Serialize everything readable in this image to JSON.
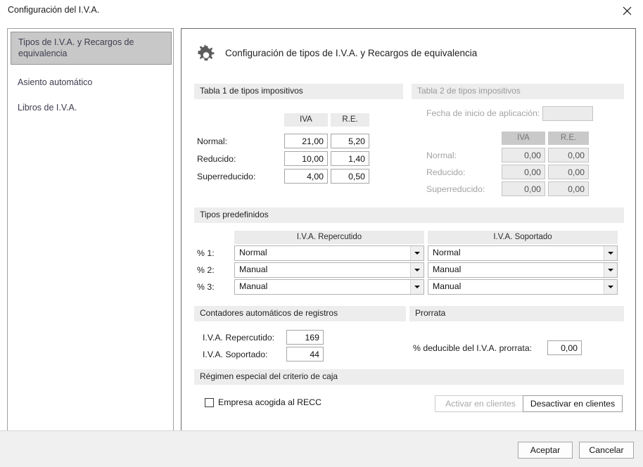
{
  "window": {
    "title": "Configuración del I.V.A.",
    "close_icon": "close-icon"
  },
  "sidebar": {
    "items": [
      {
        "label": "Tipos de I.V.A. y Recargos de equivalencia",
        "selected": true
      },
      {
        "label": "Asiento automático",
        "selected": false
      },
      {
        "label": "Libros de I.V.A.",
        "selected": false
      }
    ]
  },
  "panel": {
    "icon": "gear-icon",
    "heading": "Configuración de tipos de I.V.A. y Recargos de equivalencia"
  },
  "tabla1": {
    "section_title": "Tabla 1 de tipos impositivos",
    "col_iva": "IVA",
    "col_re": "R.E.",
    "rows": [
      {
        "label": "Normal:",
        "iva": "21,00",
        "re": "5,20"
      },
      {
        "label": "Reducido:",
        "iva": "10,00",
        "re": "1,40"
      },
      {
        "label": "Superreducido:",
        "iva": "4,00",
        "re": "0,50"
      }
    ]
  },
  "tabla2": {
    "section_title": "Tabla 2 de tipos impositivos",
    "fecha_label": "Fecha de inicio de aplicación:",
    "fecha_value": "",
    "col_iva": "IVA",
    "col_re": "R.E.",
    "rows": [
      {
        "label": "Normal:",
        "iva": "0,00",
        "re": "0,00"
      },
      {
        "label": "Reducido:",
        "iva": "0,00",
        "re": "0,00"
      },
      {
        "label": "Superreducido:",
        "iva": "0,00",
        "re": "0,00"
      }
    ]
  },
  "predefinidos": {
    "section_title": "Tipos predefinidos",
    "col_repercutido": "I.V.A. Repercutido",
    "col_soportado": "I.V.A. Soportado",
    "rows": [
      {
        "label": "% 1:",
        "repercutido": "Normal",
        "soportado": "Normal"
      },
      {
        "label": "% 2:",
        "repercutido": "Manual",
        "soportado": "Manual"
      },
      {
        "label": "% 3:",
        "repercutido": "Manual",
        "soportado": "Manual"
      }
    ]
  },
  "contadores": {
    "section_title": "Contadores automáticos de registros",
    "rows": [
      {
        "label": "I.V.A. Repercutido:",
        "value": "169"
      },
      {
        "label": "I.V.A. Soportado:",
        "value": "44"
      }
    ]
  },
  "prorrata": {
    "section_title": "Prorrata",
    "label": "% deducible del I.V.A. prorrata:",
    "value": "0,00"
  },
  "recc": {
    "section_title": "Régimen especial del criterio de caja",
    "checkbox_label": "Empresa acogida al RECC",
    "checkbox_checked": false,
    "activar_label": "Activar en clientes",
    "desactivar_label": "Desactivar en clientes"
  },
  "footer": {
    "accept_label": "Aceptar",
    "cancel_label": "Cancelar"
  }
}
